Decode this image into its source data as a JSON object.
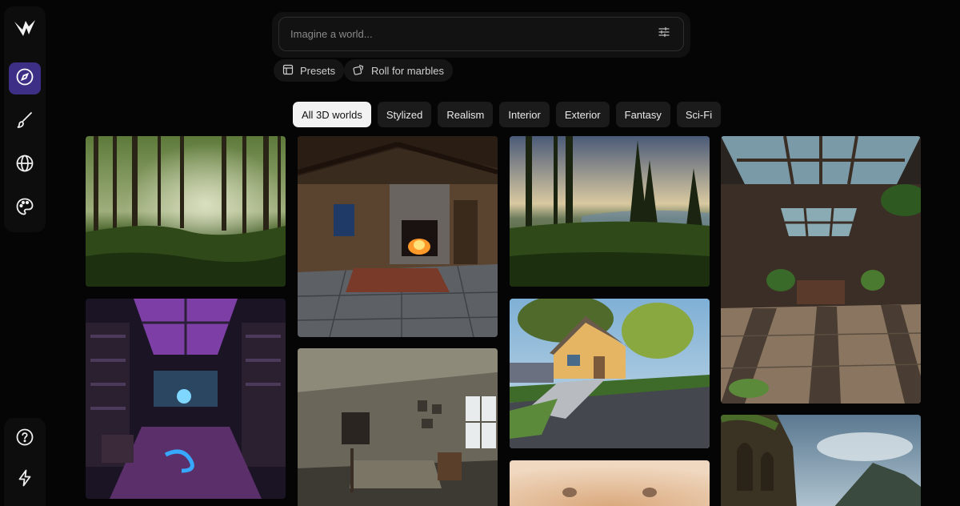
{
  "sidebar": {
    "logo": "logo-icon",
    "nav": [
      {
        "icon": "compass-icon",
        "active": true
      },
      {
        "icon": "brush-icon",
        "active": false
      },
      {
        "icon": "globe-icon",
        "active": false
      },
      {
        "icon": "palette-icon",
        "active": false
      }
    ],
    "bottom": [
      {
        "icon": "help-icon"
      },
      {
        "icon": "lightning-icon"
      }
    ]
  },
  "search": {
    "placeholder": "Imagine a world...",
    "value": "",
    "settings_icon": "sliders-icon"
  },
  "actions": {
    "presets_label": "Presets",
    "roll_label": "Roll for marbles"
  },
  "tabs": [
    {
      "label": "All 3D worlds",
      "active": true
    },
    {
      "label": "Stylized",
      "active": false
    },
    {
      "label": "Realism",
      "active": false
    },
    {
      "label": "Interior",
      "active": false
    },
    {
      "label": "Exterior",
      "active": false
    },
    {
      "label": "Fantasy",
      "active": false
    },
    {
      "label": "Sci-Fi",
      "active": false
    }
  ],
  "colors": {
    "accent": "#3d2f86",
    "background": "#050505"
  }
}
